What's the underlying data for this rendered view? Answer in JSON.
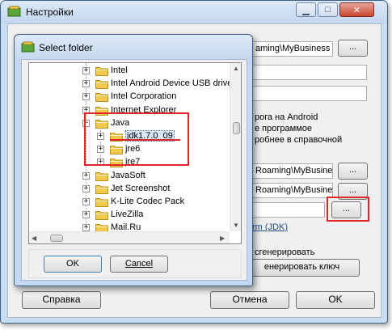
{
  "main_window": {
    "title": "Настройки",
    "fields": [
      {
        "value": "aming\\MyBusiness"
      },
      {
        "value": ""
      },
      {
        "value": ""
      },
      {
        "value": "Roaming\\MyBusiness"
      },
      {
        "value": "Roaming\\MyBusiness"
      },
      {
        "value": ""
      }
    ],
    "browse_label": "...",
    "info_lines": [
      "рога на Android",
      "е программое",
      "робнее в справочной"
    ],
    "jdk_link": "rm (JDK)",
    "generate_note": "сгенерировать",
    "generate_key_button": "енерировать ключ",
    "help_button": "Справка",
    "cancel_button": "Отмена",
    "ok_button": "OK"
  },
  "dialog": {
    "title": "Select folder",
    "tree": [
      {
        "label": "Intel",
        "expander": "+",
        "level": 0
      },
      {
        "label": "Intel Android Device USB driver",
        "expander": "+",
        "level": 0
      },
      {
        "label": "Intel Corporation",
        "expander": "+",
        "level": 0
      },
      {
        "label": "Internet Explorer",
        "expander": "+",
        "level": 0
      },
      {
        "label": "Java",
        "expander": "−",
        "level": 0
      },
      {
        "label": "jdk1.7.0_09",
        "expander": "+",
        "level": 1,
        "selected": true
      },
      {
        "label": "jre6",
        "expander": "+",
        "level": 1
      },
      {
        "label": "jre7",
        "expander": "+",
        "level": 1
      },
      {
        "label": "JavaSoft",
        "expander": "+",
        "level": 0
      },
      {
        "label": "Jet Screenshot",
        "expander": "+",
        "level": 0
      },
      {
        "label": "K-Lite Codec Pack",
        "expander": "+",
        "level": 0
      },
      {
        "label": "LiveZilla",
        "expander": "+",
        "level": 0
      },
      {
        "label": "Mail.Ru",
        "expander": "+",
        "level": 0
      }
    ],
    "ok_button": "OK",
    "cancel_button": "Cancel"
  },
  "colors": {
    "highlight_red": "#e0262a",
    "folder_yellow": "#f2c94c",
    "title_bar": "#c9dcf2"
  },
  "icons": [
    "app-icon",
    "minimize-icon",
    "maximize-icon",
    "close-icon",
    "folder-icon",
    "expander-plus-icon",
    "expander-minus-icon",
    "scroll-arrow-icon"
  ]
}
